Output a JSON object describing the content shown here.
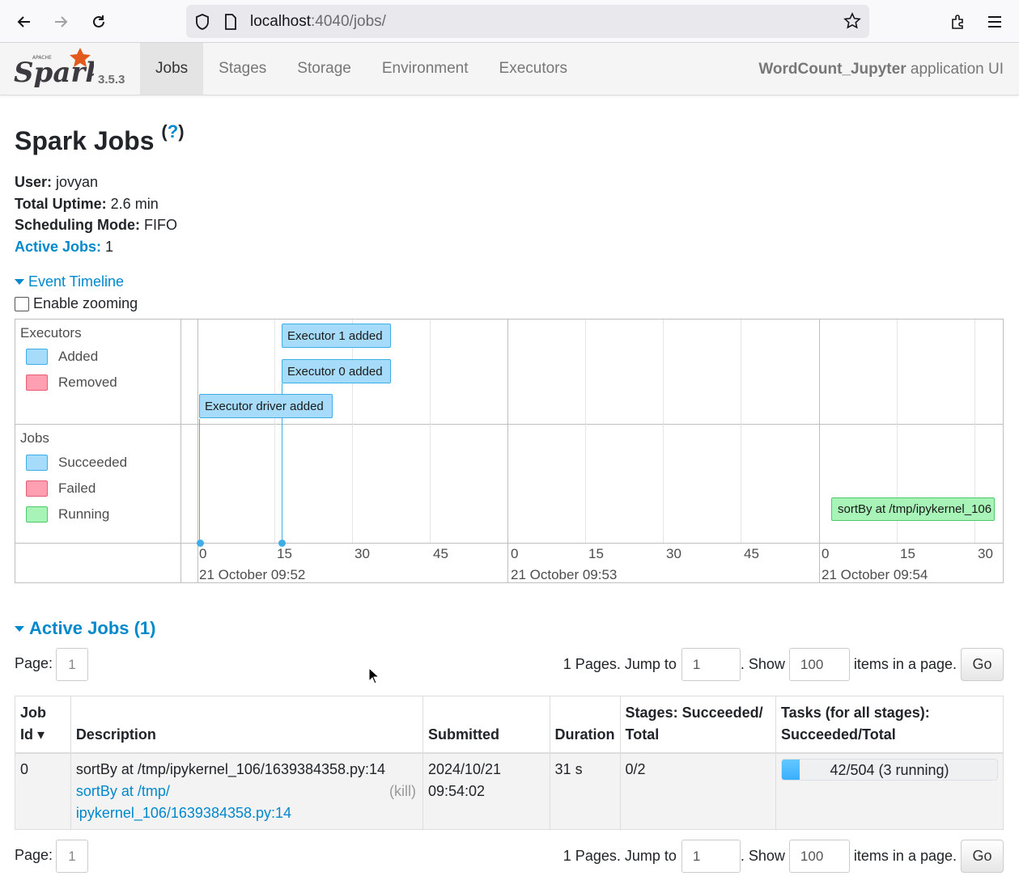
{
  "browser": {
    "url_host": "localhost",
    "url_path": ":4040/jobs/"
  },
  "nav": {
    "version": "3.5.3",
    "tabs": [
      "Jobs",
      "Stages",
      "Storage",
      "Environment",
      "Executors"
    ],
    "active_tab": "Jobs",
    "app_name": "WordCount_Jupyter",
    "app_suffix": " application UI"
  },
  "page": {
    "title": "Spark Jobs",
    "help_open": "(",
    "help_q": "?",
    "help_close": ")",
    "user_label": "User:",
    "user_value": " jovyan",
    "uptime_label": "Total Uptime:",
    "uptime_value": " 2.6 min",
    "mode_label": "Scheduling Mode:",
    "mode_value": " FIFO",
    "active_label": "Active Jobs:",
    "active_value": " 1"
  },
  "timeline": {
    "toggle_label": "Event Timeline",
    "zoom_label": "Enable zooming",
    "executors_label": "Executors",
    "executor_legend": [
      "Added",
      "Removed"
    ],
    "jobs_label": "Jobs",
    "job_legend": [
      "Succeeded",
      "Failed",
      "Running"
    ],
    "events": [
      "Executor 1 added",
      "Executor 0 added",
      "Executor driver added"
    ],
    "running_job": "sortBy at /tmp/ipykernel_106",
    "ticks": [
      "0",
      "15",
      "30",
      "45",
      "0",
      "15",
      "30",
      "45",
      "0",
      "15",
      "30"
    ],
    "major_labels": [
      "21 October 09:52",
      "21 October 09:53",
      "21 October 09:54"
    ]
  },
  "active_jobs": {
    "title": "Active Jobs (1)",
    "pager": {
      "page_label": "Page:",
      "page": "1",
      "pages_text": "1 Pages. Jump to",
      "jump": "1",
      "show_text": ". Show",
      "show": "100",
      "items_text": "items in a page.",
      "go": "Go"
    },
    "columns": {
      "job_id_1": "Job",
      "job_id_2": "Id ▾",
      "description": "Description",
      "submitted": "Submitted",
      "duration": "Duration",
      "stages_1": "Stages: Succeeded/",
      "stages_2": "Total",
      "tasks_1": "Tasks (for all stages):",
      "tasks_2": "Succeeded/Total"
    },
    "rows": [
      {
        "id": "0",
        "desc_text": "sortBy at /tmp/ipykernel_106/1639384358.py:14",
        "desc_link_1": "sortBy at /tmp/",
        "desc_link_2": "ipykernel_106/1639384358.py:14",
        "kill": "(kill)",
        "submitted_1": "2024/10/21",
        "submitted_2": "09:54:02",
        "duration": "31 s",
        "stages": "0/2",
        "tasks_text": "42/504 (3 running)",
        "tasks_fraction": 0.083
      }
    ]
  }
}
